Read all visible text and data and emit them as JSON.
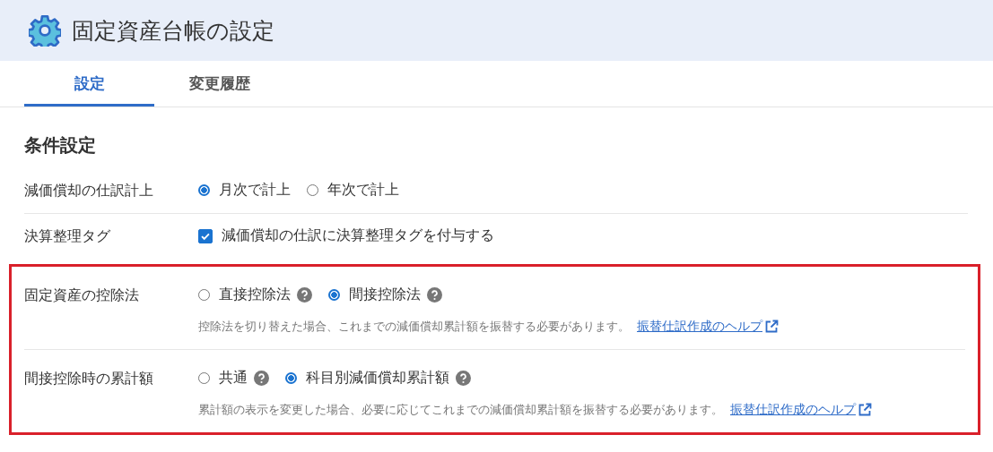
{
  "header": {
    "title": "固定資産台帳の設定"
  },
  "tabs": [
    {
      "label": "設定",
      "selected": true
    },
    {
      "label": "変更履歴",
      "selected": false
    }
  ],
  "section_title": "条件設定",
  "groups": [
    {
      "highlighted": false,
      "rows": [
        {
          "label": "減価償却の仕訳計上",
          "options": [
            {
              "kind": "radio",
              "label": "月次で計上",
              "selected": true,
              "help": false
            },
            {
              "kind": "radio",
              "label": "年次で計上",
              "selected": false,
              "help": false
            }
          ]
        },
        {
          "label": "決算整理タグ",
          "options": [
            {
              "kind": "checkbox",
              "label": "減価償却の仕訳に決算整理タグを付与する",
              "checked": true,
              "help": false
            }
          ]
        }
      ]
    },
    {
      "highlighted": true,
      "rows": [
        {
          "label": "固定資産の控除法",
          "options": [
            {
              "kind": "radio",
              "label": "直接控除法",
              "selected": false,
              "help": true
            },
            {
              "kind": "radio",
              "label": "間接控除法",
              "selected": true,
              "help": true
            }
          ],
          "hint": "控除法を切り替えた場合、これまでの減価償却累計額を振替する必要があります。",
          "link": "振替仕訳作成のヘルプ"
        },
        {
          "label": "間接控除時の累計額",
          "options": [
            {
              "kind": "radio",
              "label": "共通",
              "selected": false,
              "help": true
            },
            {
              "kind": "radio",
              "label": "科目別減価償却累計額",
              "selected": true,
              "help": true
            }
          ],
          "hint": "累計額の表示を変更した場合、必要に応じてこれまでの減価償却累計額を振替する必要があります。",
          "link": "振替仕訳作成のヘルプ"
        }
      ]
    }
  ]
}
